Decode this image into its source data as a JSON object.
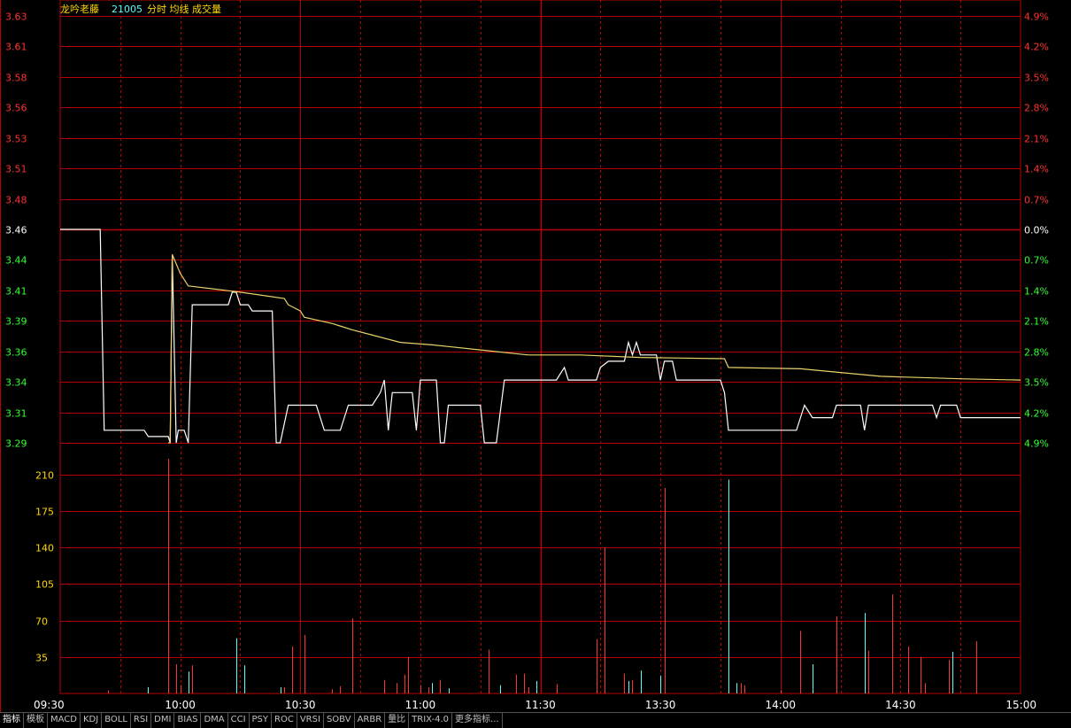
{
  "header": {
    "stock_name": "龙吟老藤",
    "stock_code": "21005",
    "view_label": "分时 均线 成交量"
  },
  "colors": {
    "grid": "#b80000",
    "price_line": "#ffffff",
    "avg_line": "#e8d36a",
    "up_text": "#ff3232",
    "down_text": "#32ff32",
    "neutral_text": "#ffffff",
    "vol_up": "#ff3232",
    "vol_down": "#54ffff",
    "vol_axis": "#ffd700"
  },
  "chart_data": [
    {
      "type": "line",
      "title": "",
      "base_price": 3.46,
      "ylim": [
        3.29,
        3.63
      ],
      "price_ticks": [
        "3.63",
        "3.61",
        "3.58",
        "3.56",
        "3.53",
        "3.51",
        "3.48",
        "3.46",
        "3.44",
        "3.41",
        "3.39",
        "3.36",
        "3.34",
        "3.31",
        "3.29"
      ],
      "pct_ticks": [
        "4.9%",
        "4.2%",
        "3.5%",
        "2.8%",
        "2.1%",
        "1.4%",
        "0.7%",
        "0.0%",
        "0.7%",
        "1.4%",
        "2.1%",
        "2.8%",
        "3.5%",
        "4.2%",
        "4.9%"
      ],
      "time_labels": [
        "09:30",
        "10:00",
        "10:30",
        "11:00",
        "11:30",
        "13:30",
        "14:00",
        "14:30",
        "15:00"
      ],
      "x_range_minutes": [
        0,
        240
      ],
      "series": [
        {
          "key": "price",
          "points": [
            [
              0,
              3.46
            ],
            [
              10,
              3.46
            ],
            [
              11,
              3.3
            ],
            [
              21,
              3.3
            ],
            [
              22,
              3.295
            ],
            [
              27,
              3.295
            ],
            [
              27.5,
              3.29
            ],
            [
              28,
              3.44
            ],
            [
              29,
              3.29
            ],
            [
              29.5,
              3.3
            ],
            [
              31,
              3.3
            ],
            [
              32,
              3.29
            ],
            [
              33,
              3.4
            ],
            [
              42,
              3.4
            ],
            [
              43,
              3.41
            ],
            [
              44,
              3.41
            ],
            [
              45,
              3.4
            ],
            [
              47,
              3.4
            ],
            [
              48,
              3.395
            ],
            [
              53,
              3.395
            ],
            [
              54,
              3.29
            ],
            [
              55,
              3.29
            ],
            [
              57,
              3.32
            ],
            [
              64,
              3.32
            ],
            [
              66,
              3.3
            ],
            [
              70,
              3.3
            ],
            [
              72,
              3.32
            ],
            [
              78,
              3.32
            ],
            [
              80,
              3.33
            ],
            [
              81,
              3.34
            ],
            [
              82,
              3.3
            ],
            [
              83,
              3.33
            ],
            [
              88,
              3.33
            ],
            [
              89,
              3.3
            ],
            [
              90,
              3.34
            ],
            [
              94,
              3.34
            ],
            [
              95,
              3.29
            ],
            [
              96,
              3.29
            ],
            [
              97,
              3.32
            ],
            [
              105,
              3.32
            ],
            [
              106,
              3.29
            ],
            [
              109,
              3.29
            ],
            [
              111,
              3.34
            ],
            [
              124,
              3.34
            ],
            [
              126,
              3.35
            ],
            [
              127,
              3.34
            ],
            [
              134,
              3.34
            ],
            [
              135,
              3.35
            ],
            [
              137,
              3.355
            ],
            [
              141,
              3.355
            ],
            [
              142,
              3.37
            ],
            [
              143,
              3.36
            ],
            [
              144,
              3.37
            ],
            [
              145,
              3.36
            ],
            [
              149,
              3.36
            ],
            [
              150,
              3.34
            ],
            [
              151,
              3.355
            ],
            [
              153,
              3.355
            ],
            [
              154,
              3.34
            ],
            [
              165,
              3.34
            ],
            [
              166,
              3.33
            ],
            [
              167,
              3.3
            ],
            [
              184,
              3.3
            ],
            [
              186,
              3.32
            ],
            [
              188,
              3.31
            ],
            [
              193,
              3.31
            ],
            [
              194,
              3.32
            ],
            [
              200,
              3.32
            ],
            [
              201,
              3.3
            ],
            [
              202,
              3.32
            ],
            [
              218,
              3.32
            ],
            [
              219,
              3.31
            ],
            [
              220,
              3.32
            ],
            [
              224,
              3.32
            ],
            [
              225,
              3.31
            ],
            [
              240,
              3.31
            ]
          ]
        },
        {
          "key": "average",
          "points": [
            [
              27,
              3.29
            ],
            [
              27.5,
              3.29
            ],
            [
              28,
              3.44
            ],
            [
              30,
              3.425
            ],
            [
              31,
              3.42
            ],
            [
              32,
              3.415
            ],
            [
              45,
              3.41
            ],
            [
              56,
              3.405
            ],
            [
              57,
              3.4
            ],
            [
              60,
              3.395
            ],
            [
              61,
              3.39
            ],
            [
              68,
              3.385
            ],
            [
              73,
              3.38
            ],
            [
              79,
              3.375
            ],
            [
              85,
              3.37
            ],
            [
              93,
              3.368
            ],
            [
              105,
              3.364
            ],
            [
              117,
              3.36
            ],
            [
              130,
              3.36
            ],
            [
              145,
              3.358
            ],
            [
              166,
              3.357
            ],
            [
              167,
              3.35
            ],
            [
              185,
              3.349
            ],
            [
              195,
              3.346
            ],
            [
              205,
              3.343
            ],
            [
              215,
              3.342
            ],
            [
              225,
              3.341
            ],
            [
              240,
              3.34
            ]
          ]
        }
      ]
    },
    {
      "type": "bar",
      "title": "",
      "ylabel": "",
      "ylim": [
        0,
        225
      ],
      "y_ticks": [
        "210",
        "175",
        "140",
        "105",
        "70",
        "35"
      ],
      "bars": [
        {
          "t": 12,
          "v": 3,
          "d": "up"
        },
        {
          "t": 22,
          "v": 6,
          "d": "down"
        },
        {
          "t": 27,
          "v": 225,
          "d": "up"
        },
        {
          "t": 29,
          "v": 28,
          "d": "up"
        },
        {
          "t": 30,
          "v": 8,
          "d": "up"
        },
        {
          "t": 32,
          "v": 21,
          "d": "down"
        },
        {
          "t": 33,
          "v": 27,
          "d": "up"
        },
        {
          "t": 44,
          "v": 53,
          "d": "down"
        },
        {
          "t": 46,
          "v": 27,
          "d": "down"
        },
        {
          "t": 55,
          "v": 6,
          "d": "down"
        },
        {
          "t": 56,
          "v": 6,
          "d": "up"
        },
        {
          "t": 58,
          "v": 45,
          "d": "up"
        },
        {
          "t": 61,
          "v": 56,
          "d": "up"
        },
        {
          "t": 68,
          "v": 4,
          "d": "up"
        },
        {
          "t": 70,
          "v": 7,
          "d": "up"
        },
        {
          "t": 73,
          "v": 72,
          "d": "up"
        },
        {
          "t": 81,
          "v": 13,
          "d": "up"
        },
        {
          "t": 84,
          "v": 10,
          "d": "up"
        },
        {
          "t": 86,
          "v": 18,
          "d": "up"
        },
        {
          "t": 87,
          "v": 35,
          "d": "up"
        },
        {
          "t": 90,
          "v": 8,
          "d": "up"
        },
        {
          "t": 92,
          "v": 6,
          "d": "up"
        },
        {
          "t": 93,
          "v": 10,
          "d": "down"
        },
        {
          "t": 95,
          "v": 13,
          "d": "up"
        },
        {
          "t": 97,
          "v": 5,
          "d": "down"
        },
        {
          "t": 107,
          "v": 42,
          "d": "up"
        },
        {
          "t": 110,
          "v": 8,
          "d": "down"
        },
        {
          "t": 114,
          "v": 18,
          "d": "up"
        },
        {
          "t": 116,
          "v": 19,
          "d": "up"
        },
        {
          "t": 117,
          "v": 6,
          "d": "up"
        },
        {
          "t": 119,
          "v": 12,
          "d": "down"
        },
        {
          "t": 124,
          "v": 9,
          "d": "up"
        },
        {
          "t": 134,
          "v": 52,
          "d": "up"
        },
        {
          "t": 136,
          "v": 140,
          "d": "up"
        },
        {
          "t": 141,
          "v": 19,
          "d": "up"
        },
        {
          "t": 142,
          "v": 12,
          "d": "down"
        },
        {
          "t": 143,
          "v": 13,
          "d": "up"
        },
        {
          "t": 145,
          "v": 22,
          "d": "down"
        },
        {
          "t": 150,
          "v": 17,
          "d": "down"
        },
        {
          "t": 151,
          "v": 197,
          "d": "up"
        },
        {
          "t": 167,
          "v": 205,
          "d": "down"
        },
        {
          "t": 169,
          "v": 10,
          "d": "down"
        },
        {
          "t": 170,
          "v": 10,
          "d": "up"
        },
        {
          "t": 171,
          "v": 8,
          "d": "up"
        },
        {
          "t": 180,
          "v": 3,
          "d": "up"
        },
        {
          "t": 185,
          "v": 60,
          "d": "up"
        },
        {
          "t": 188,
          "v": 28,
          "d": "down"
        },
        {
          "t": 194,
          "v": 74,
          "d": "up"
        },
        {
          "t": 201,
          "v": 77,
          "d": "down"
        },
        {
          "t": 202,
          "v": 41,
          "d": "up"
        },
        {
          "t": 208,
          "v": 95,
          "d": "up"
        },
        {
          "t": 212,
          "v": 45,
          "d": "up"
        },
        {
          "t": 215,
          "v": 35,
          "d": "up"
        },
        {
          "t": 216,
          "v": 10,
          "d": "up"
        },
        {
          "t": 222,
          "v": 32,
          "d": "up"
        },
        {
          "t": 223,
          "v": 40,
          "d": "down"
        },
        {
          "t": 229,
          "v": 50,
          "d": "up"
        }
      ]
    }
  ],
  "indicator_tabs": [
    "指标",
    "模板",
    "MACD",
    "KDJ",
    "BOLL",
    "RSI",
    "DMI",
    "BIAS",
    "DMA",
    "CCI",
    "PSY",
    "ROC",
    "VRSI",
    "SOBV",
    "ARBR",
    "量比",
    "TRIX-4.0",
    "更多指标..."
  ]
}
